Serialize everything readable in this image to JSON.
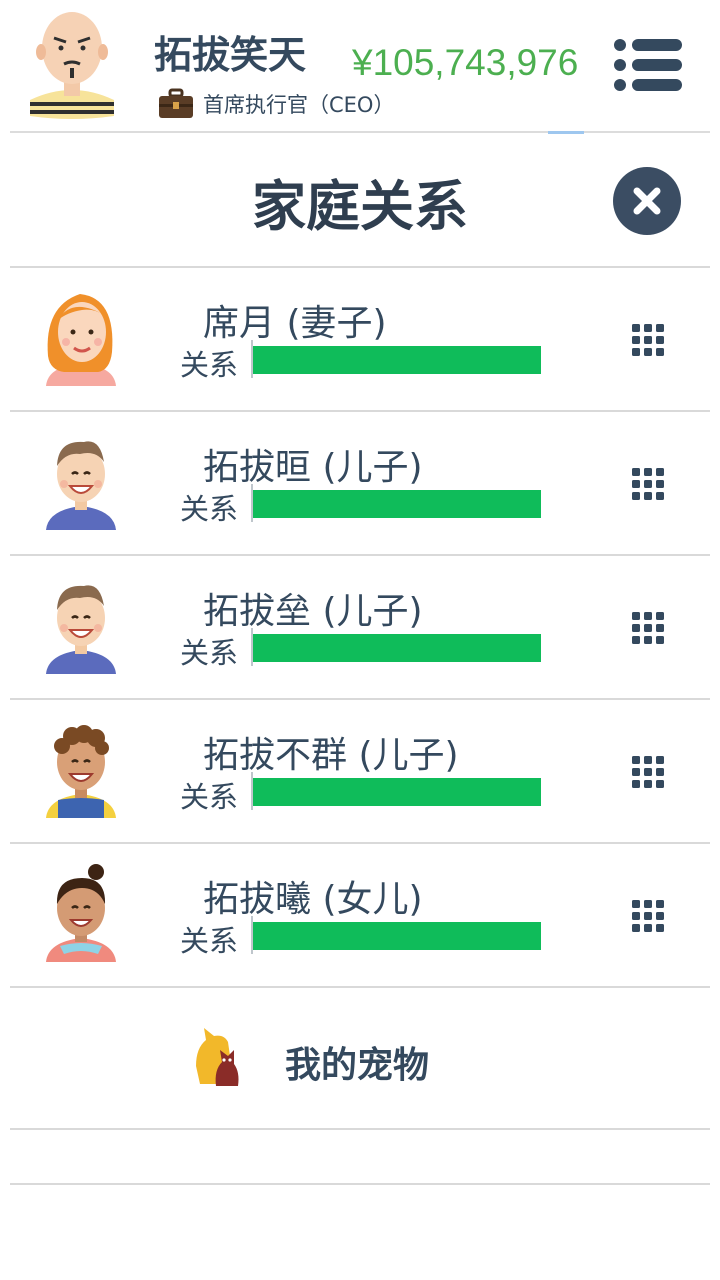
{
  "player": {
    "name": "拓拔笑天",
    "job_title": "首席执行官（CEO）",
    "money": "¥105,743,976"
  },
  "title": "家庭关系",
  "relation_label": "关系",
  "members": [
    {
      "name": "席月 (妻子)",
      "relationship": 1.0,
      "avatar": "wife-avatar"
    },
    {
      "name": "拓拔晅 (儿子)",
      "relationship": 1.0,
      "avatar": "son-avatar"
    },
    {
      "name": "拓拔垒 (儿子)",
      "relationship": 1.0,
      "avatar": "son-avatar"
    },
    {
      "name": "拓拔不群 (儿子)",
      "relationship": 1.0,
      "avatar": "son-curly-avatar"
    },
    {
      "name": "拓拔曦 (女儿)",
      "relationship": 1.0,
      "avatar": "daughter-avatar"
    }
  ],
  "pets": {
    "label": "我的宠物"
  },
  "colors": {
    "text": "#34495e",
    "money": "#4caf50",
    "bar": "#0fbc5a",
    "close_bg": "#3b4d63"
  },
  "icons": {
    "menu": "menu-list-icon",
    "close": "close-icon",
    "options": "grid-dots-icon",
    "briefcase": "briefcase-icon",
    "pet": "pets-icon"
  }
}
